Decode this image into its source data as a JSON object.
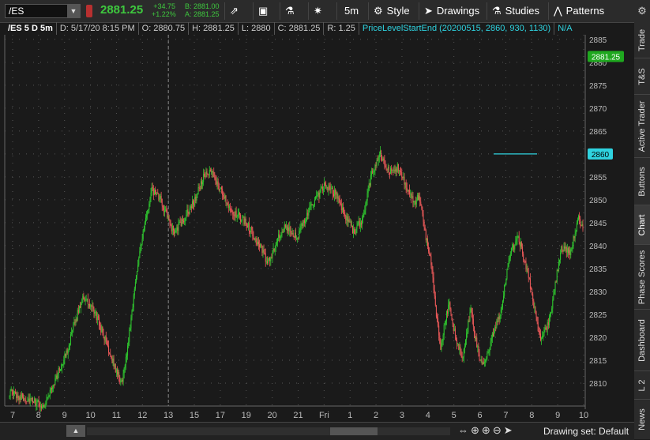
{
  "toolbar": {
    "symbol": "/ES",
    "last_price": "2881.25",
    "change_abs": "+34.75",
    "change_pct": "+1.22%",
    "bid": "B: 2881.00",
    "ask": "A: 2881.25",
    "aggregation": "5m",
    "style_label": "Style",
    "drawings_label": "Drawings",
    "studies_label": "Studies",
    "patterns_label": "Patterns"
  },
  "infobar": {
    "title": "/ES 5 D 5m",
    "date": "D: 5/17/20 8:15 PM",
    "open": "O: 2880.75",
    "high": "H: 2881.25",
    "low": "L: 2880",
    "close": "C: 2881.25",
    "range": "R: 1.25",
    "study": "PriceLevelStartEnd (20200515, 2860, 930, 1130)",
    "study_value": "N/A"
  },
  "colors": {
    "up": "#2fc82f",
    "down": "#ee5a5a",
    "level": "#2fd3e0",
    "price_tag": "#1fa81f",
    "background": "#1a1a1a"
  },
  "sidebar": {
    "tabs": [
      "Trade",
      "T&S",
      "Active Trader",
      "Buttons",
      "Chart",
      "Phase Scores",
      "Dashboard",
      "L 2",
      "News"
    ],
    "active": "Chart"
  },
  "bottom": {
    "drawing_set": "Drawing set: Default"
  },
  "chart_data": {
    "type": "candlestick",
    "y_ticks": [
      2810,
      2815,
      2820,
      2825,
      2830,
      2835,
      2840,
      2845,
      2850,
      2855,
      2860,
      2865,
      2870,
      2875,
      2880,
      2885
    ],
    "ylim": [
      2805,
      2886
    ],
    "x_ticks": [
      "7",
      "8",
      "9",
      "10",
      "11",
      "12",
      "13",
      "15",
      "17",
      "19",
      "20",
      "21",
      "Fri",
      "1",
      "2",
      "3",
      "4",
      "5",
      "6",
      "7",
      "8",
      "9",
      "10"
    ],
    "last_price": 2881.25,
    "level_line": {
      "label": "2860",
      "value": 2860
    },
    "path": [
      [
        0,
        2808
      ],
      [
        8,
        2805
      ],
      [
        13,
        2816
      ],
      [
        17,
        2829
      ],
      [
        20,
        2825
      ],
      [
        22,
        2820
      ],
      [
        25,
        2812
      ],
      [
        26,
        2810
      ],
      [
        27,
        2815
      ],
      [
        30,
        2838
      ],
      [
        33,
        2852
      ],
      [
        35,
        2850
      ],
      [
        38,
        2843
      ],
      [
        40,
        2845
      ],
      [
        43,
        2850
      ],
      [
        45,
        2855
      ],
      [
        47,
        2856
      ],
      [
        49,
        2852
      ],
      [
        52,
        2847
      ],
      [
        55,
        2845
      ],
      [
        58,
        2840
      ],
      [
        60,
        2836
      ],
      [
        62,
        2841
      ],
      [
        64,
        2844
      ],
      [
        67,
        2842
      ],
      [
        69,
        2847
      ],
      [
        71,
        2850
      ],
      [
        73,
        2853
      ],
      [
        76,
        2851
      ],
      [
        78,
        2846
      ],
      [
        80,
        2843
      ],
      [
        82,
        2846
      ],
      [
        84,
        2856
      ],
      [
        86,
        2860
      ],
      [
        88,
        2856
      ],
      [
        90,
        2857
      ],
      [
        92,
        2853
      ],
      [
        94,
        2849
      ],
      [
        95,
        2851
      ],
      [
        96,
        2845
      ],
      [
        98,
        2835
      ],
      [
        99,
        2825
      ],
      [
        100,
        2818
      ],
      [
        102,
        2828
      ],
      [
        103,
        2822
      ],
      [
        105,
        2815
      ],
      [
        107,
        2826
      ],
      [
        109,
        2815
      ],
      [
        110,
        2814
      ],
      [
        112,
        2820
      ],
      [
        114,
        2826
      ],
      [
        116,
        2838
      ],
      [
        118,
        2842
      ],
      [
        120,
        2835
      ],
      [
        122,
        2825
      ],
      [
        123,
        2820
      ],
      [
        125,
        2823
      ],
      [
        126,
        2828
      ],
      [
        128,
        2840
      ],
      [
        130,
        2838
      ],
      [
        132,
        2846
      ],
      [
        133,
        2844
      ]
    ]
  }
}
